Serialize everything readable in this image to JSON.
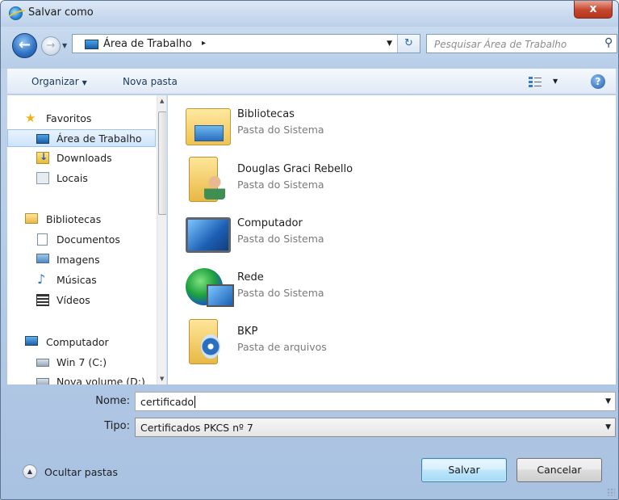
{
  "window": {
    "title": "Salvar como",
    "close_label": "x"
  },
  "nav": {
    "back_glyph": "←",
    "forward_glyph": "→",
    "address_location": "Área de Trabalho",
    "address_separator": "▸",
    "refresh_glyph": "↻",
    "search_placeholder": "Pesquisar Área de Trabalho",
    "search_glyph": "⚲"
  },
  "toolbar": {
    "organize_label": "Organizar",
    "new_folder_label": "Nova pasta",
    "help_glyph": "?"
  },
  "sidebar": {
    "items": [
      {
        "label": "Favoritos",
        "icon": "star-icon"
      },
      {
        "label": "Área de Trabalho",
        "icon": "desktop-icon",
        "selected": true
      },
      {
        "label": "Downloads",
        "icon": "downloads-folder-icon"
      },
      {
        "label": "Locais",
        "icon": "recent-places-icon"
      },
      {
        "label": "Bibliotecas",
        "icon": "libraries-icon"
      },
      {
        "label": "Documentos",
        "icon": "documents-icon"
      },
      {
        "label": "Imagens",
        "icon": "pictures-icon"
      },
      {
        "label": "Músicas",
        "icon": "music-icon"
      },
      {
        "label": "Vídeos",
        "icon": "videos-icon"
      },
      {
        "label": "Computador",
        "icon": "computer-icon"
      },
      {
        "label": "Win 7 (C:)",
        "icon": "drive-icon"
      },
      {
        "label": "Nova volume (D:)",
        "icon": "drive-icon"
      }
    ]
  },
  "files": [
    {
      "name": "Bibliotecas",
      "type": "Pasta do Sistema",
      "icon": "libraries-folder-icon"
    },
    {
      "name": "Douglas Graci Rebello",
      "type": "Pasta do Sistema",
      "icon": "user-folder-icon"
    },
    {
      "name": "Computador",
      "type": "Pasta do Sistema",
      "icon": "computer-icon"
    },
    {
      "name": "Rede",
      "type": "Pasta do Sistema",
      "icon": "network-icon"
    },
    {
      "name": "BKP",
      "type": "Pasta de arquivos",
      "icon": "folder-icon"
    }
  ],
  "form": {
    "name_label": "Nome:",
    "name_value": "certificado",
    "type_label": "Tipo:",
    "type_value": "Certificados PKCS nº 7"
  },
  "footer": {
    "hide_folders_label": "Ocultar pastas",
    "save_label": "Salvar",
    "cancel_label": "Cancelar"
  }
}
